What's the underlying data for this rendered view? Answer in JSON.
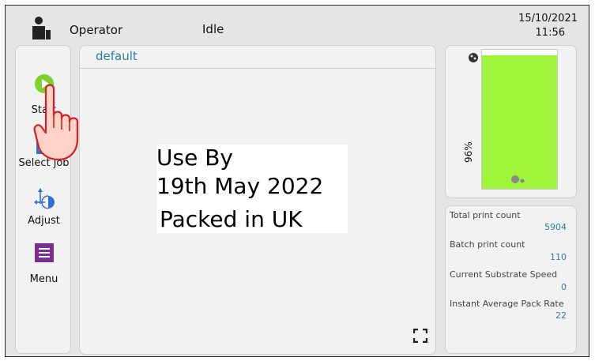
{
  "header": {
    "user_name": "Operator",
    "status": "Idle",
    "date": "15/10/2021",
    "time": "11:56"
  },
  "nav": {
    "items": [
      {
        "label": "Start",
        "icon": "play-icon",
        "color": "#7ed12e"
      },
      {
        "label": "Select job",
        "icon": "document-icon",
        "color": "#2f6fd6"
      },
      {
        "label": "Adjust",
        "icon": "adjust-icon",
        "color": "#2f6fd6"
      },
      {
        "label": "Menu",
        "icon": "menu-icon",
        "color": "#7a2e8e"
      }
    ]
  },
  "main": {
    "job_name": "default",
    "label_preview": {
      "line1": "Use By",
      "line2": "19th May 2022",
      "line3": "Packed in UK"
    }
  },
  "ink": {
    "level_text": "96%",
    "level_fraction": 0.96,
    "fill_color": "#9ff53a"
  },
  "stats": [
    {
      "label": "Total print count",
      "value": "5904"
    },
    {
      "label": "Batch print count",
      "value": "110"
    },
    {
      "label": "Current Substrate Speed",
      "value": "0"
    },
    {
      "label": "Instant Average Pack Rate",
      "value": "22"
    }
  ]
}
